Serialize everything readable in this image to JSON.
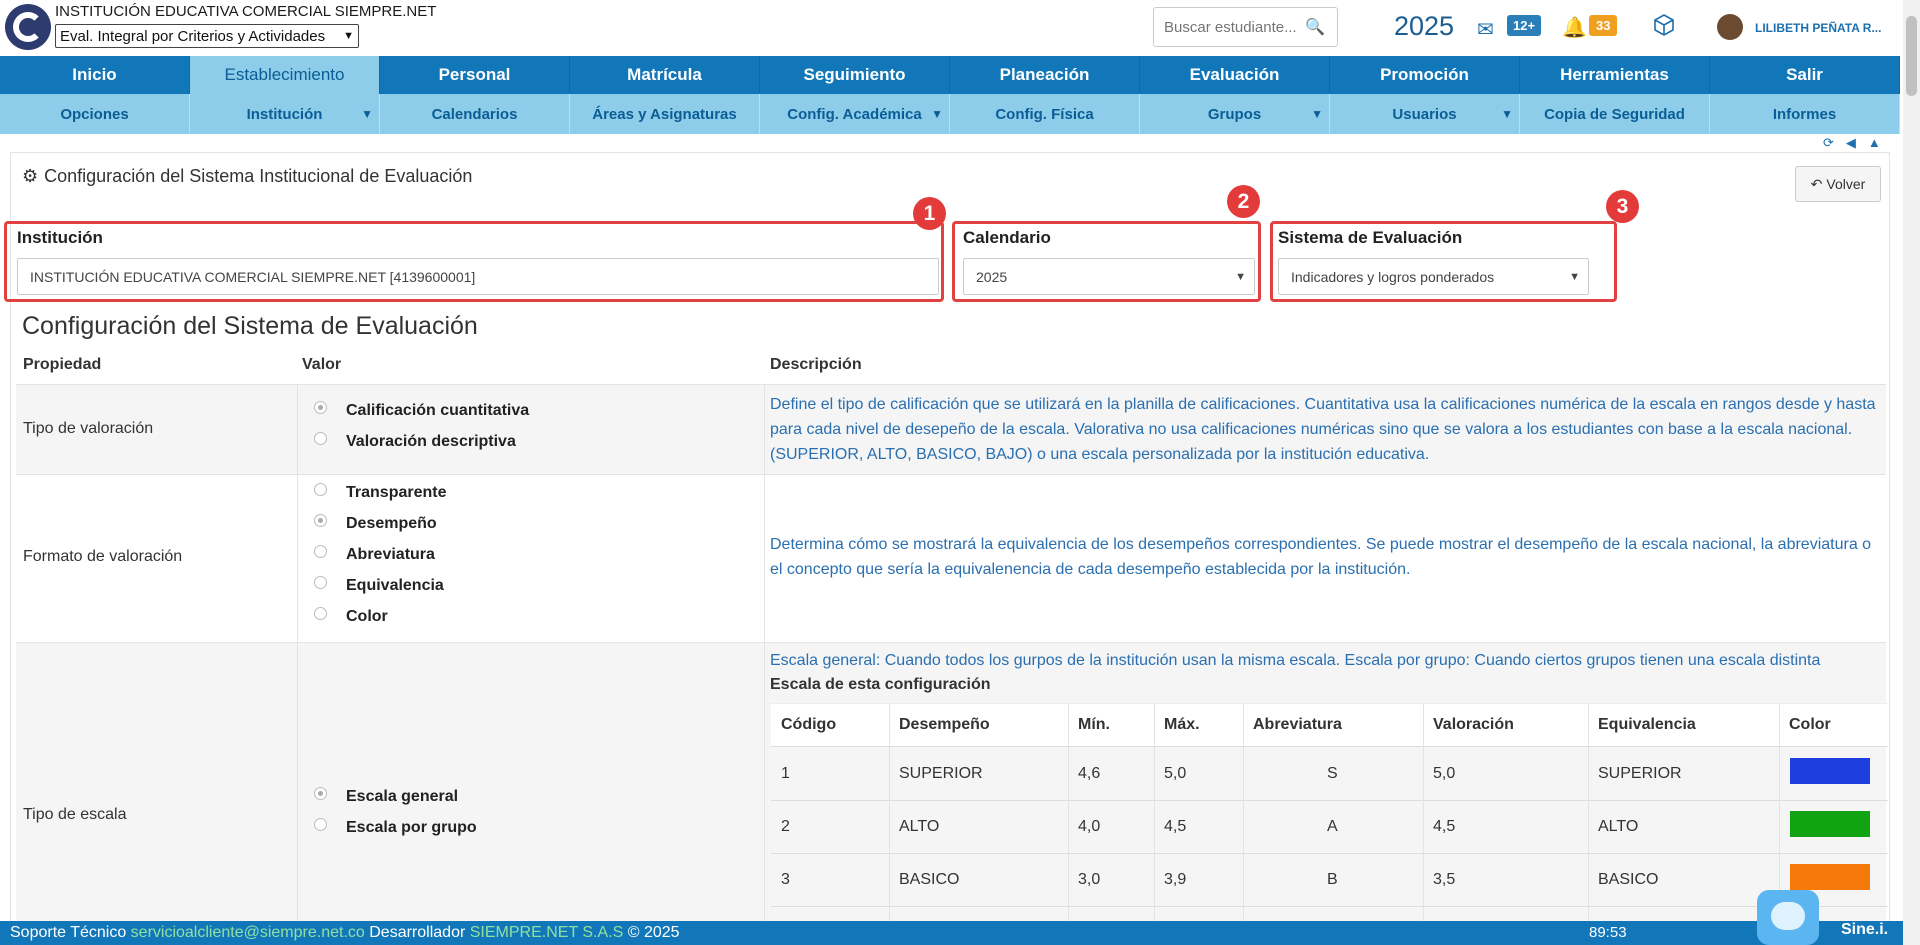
{
  "header": {
    "institution_name": "INSTITUCIÓN EDUCATIVA COMERCIAL SIEMPRE.NET",
    "mode_select": "Eval. Integral por Criterios y Actividades",
    "search_placeholder": "Buscar estudiante...",
    "year": "2025",
    "mail_badge": "12+",
    "notif_badge": "33",
    "user_name": "LILIBETH PEÑATA R..."
  },
  "nav": {
    "main": [
      "Inicio",
      "Establecimiento",
      "Personal",
      "Matrícula",
      "Seguimiento",
      "Planeación",
      "Evaluación",
      "Promoción",
      "Herramientas",
      "Salir"
    ],
    "active_main": "Establecimiento",
    "sub": [
      "Opciones",
      "Institución",
      "Calendarios",
      "Áreas y Asignaturas",
      "Config. Académica",
      "Config. Física",
      "Grupos",
      "Usuarios",
      "Copia de Seguridad",
      "Informes"
    ]
  },
  "page": {
    "title": "Configuración del Sistema Institucional de Evaluación",
    "back_label": "Volver",
    "institution_label": "Institución",
    "institution_value": "INSTITUCIÓN EDUCATIVA COMERCIAL SIEMPRE.NET [4139600001]",
    "calendar_label": "Calendario",
    "calendar_value": "2025",
    "system_label": "Sistema de Evaluación",
    "system_value": "Indicadores y logros ponderados",
    "markers": [
      "1",
      "2",
      "3"
    ],
    "section_title": "Configuración del Sistema de Evaluación"
  },
  "config_table": {
    "headers": [
      "Propiedad",
      "Valor",
      "Descripción"
    ],
    "rows": [
      {
        "property": "Tipo de valoración",
        "options": [
          "Calificación cuantitativa",
          "Valoración descriptiva"
        ],
        "selected": 0,
        "description": "Define el tipo de calificación que se utilizará en la planilla de calificaciones. Cuantitativa usa la calificaciones numérica de la escala en rangos desde y hasta para cada nivel de desepeño de la escala. Valorativa no usa calificaciones numéricas sino que se valora a los estudiantes con base a la escala nacional. (SUPERIOR, ALTO, BASICO, BAJO) o una escala personalizada por la institución educativa."
      },
      {
        "property": "Formato de valoración",
        "options": [
          "Transparente",
          "Desempeño",
          "Abreviatura",
          "Equivalencia",
          "Color"
        ],
        "selected": 1,
        "description": "Determina cómo se mostrará la equivalencia de los desempeños correspondientes. Se puede mostrar el desempeño de la escala nacional, la abreviatura o el concepto que sería la equivalenencia de cada desempeño establecida por la institución."
      },
      {
        "property": "Tipo de escala",
        "options": [
          "Escala general",
          "Escala por grupo"
        ],
        "selected": 0,
        "description": "Escala general: Cuando todos los gurpos de la institución usan la misma escala. Escala por grupo: Cuando ciertos grupos tienen una escala distinta",
        "scale_title": "Escala de esta configuración"
      }
    ]
  },
  "scale_table": {
    "headers": [
      "Código",
      "Desempeño",
      "Mín.",
      "Máx.",
      "Abreviatura",
      "Valoración",
      "Equivalencia",
      "Color"
    ],
    "rows": [
      {
        "code": "1",
        "performance": "SUPERIOR",
        "min": "4,6",
        "max": "5,0",
        "abbr": "S",
        "value": "5,0",
        "equivalence": "SUPERIOR",
        "color": "#1f3ee0"
      },
      {
        "code": "2",
        "performance": "ALTO",
        "min": "4,0",
        "max": "4,5",
        "abbr": "A",
        "value": "4,5",
        "equivalence": "ALTO",
        "color": "#12a312"
      },
      {
        "code": "3",
        "performance": "BASICO",
        "min": "3,0",
        "max": "3,9",
        "abbr": "B",
        "value": "3,5",
        "equivalence": "BASICO",
        "color": "#f57a0a"
      }
    ]
  },
  "footer": {
    "support_label": "Soporte Técnico",
    "support_email": "servicioalcliente@siempre.net.co",
    "developer_label": "Desarrollador",
    "developer_name": "SIEMPRE.NET S.A.S",
    "copyright": "© 2025",
    "timer": "89:53",
    "brand": "Sine.i."
  },
  "colors": {
    "primary": "#1177b9",
    "subnav": "#8dcdea",
    "highlight": "#e24141",
    "link": "#2a6fb0"
  }
}
